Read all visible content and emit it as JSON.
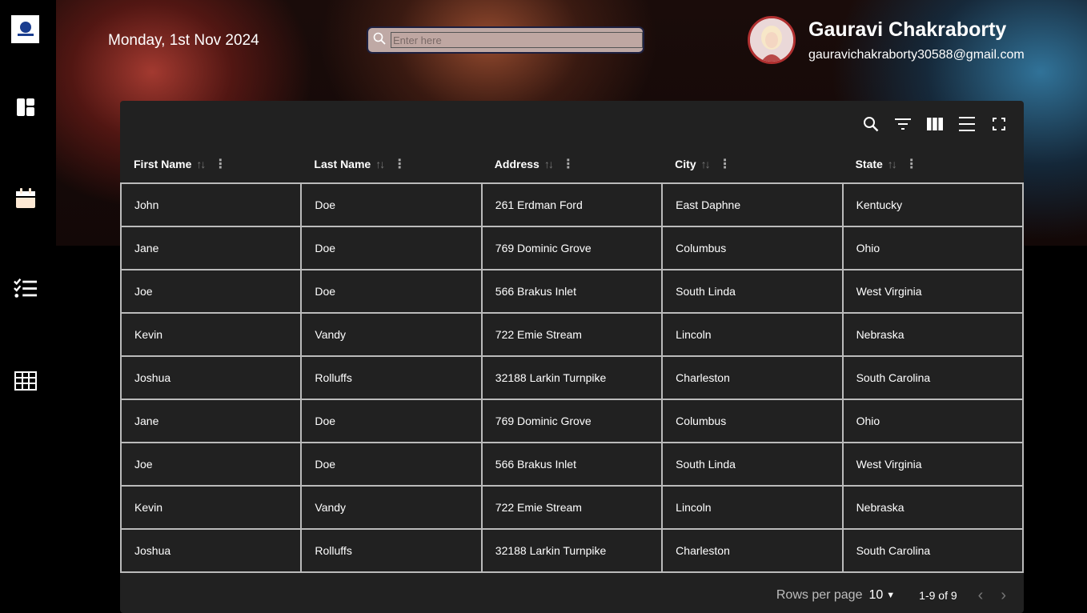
{
  "header": {
    "date": "Monday, 1st Nov 2024",
    "search_placeholder": "Enter here",
    "user_name": "Gauravi Chakraborty",
    "user_email": "gauravichakraborty30588@gmail.com"
  },
  "sidebar": {
    "items": [
      {
        "icon": "dashboard-icon"
      },
      {
        "icon": "calendar-icon"
      },
      {
        "icon": "checklist-icon"
      },
      {
        "icon": "table-icon"
      }
    ]
  },
  "table": {
    "columns": [
      "First Name",
      "Last Name",
      "Address",
      "City",
      "State"
    ],
    "rows": [
      [
        "John",
        "Doe",
        "261 Erdman Ford",
        "East Daphne",
        "Kentucky"
      ],
      [
        "Jane",
        "Doe",
        "769 Dominic Grove",
        "Columbus",
        "Ohio"
      ],
      [
        "Joe",
        "Doe",
        "566 Brakus Inlet",
        "South Linda",
        "West Virginia"
      ],
      [
        "Kevin",
        "Vandy",
        "722 Emie Stream",
        "Lincoln",
        "Nebraska"
      ],
      [
        "Joshua",
        "Rolluffs",
        "32188 Larkin Turnpike",
        "Charleston",
        "South Carolina"
      ],
      [
        "Jane",
        "Doe",
        "769 Dominic Grove",
        "Columbus",
        "Ohio"
      ],
      [
        "Joe",
        "Doe",
        "566 Brakus Inlet",
        "South Linda",
        "West Virginia"
      ],
      [
        "Kevin",
        "Vandy",
        "722 Emie Stream",
        "Lincoln",
        "Nebraska"
      ],
      [
        "Joshua",
        "Rolluffs",
        "32188 Larkin Turnpike",
        "Charleston",
        "South Carolina"
      ]
    ]
  },
  "pagination": {
    "rows_per_page_label": "Rows per page",
    "rows_per_page": "10",
    "range": "1-9 of 9"
  }
}
